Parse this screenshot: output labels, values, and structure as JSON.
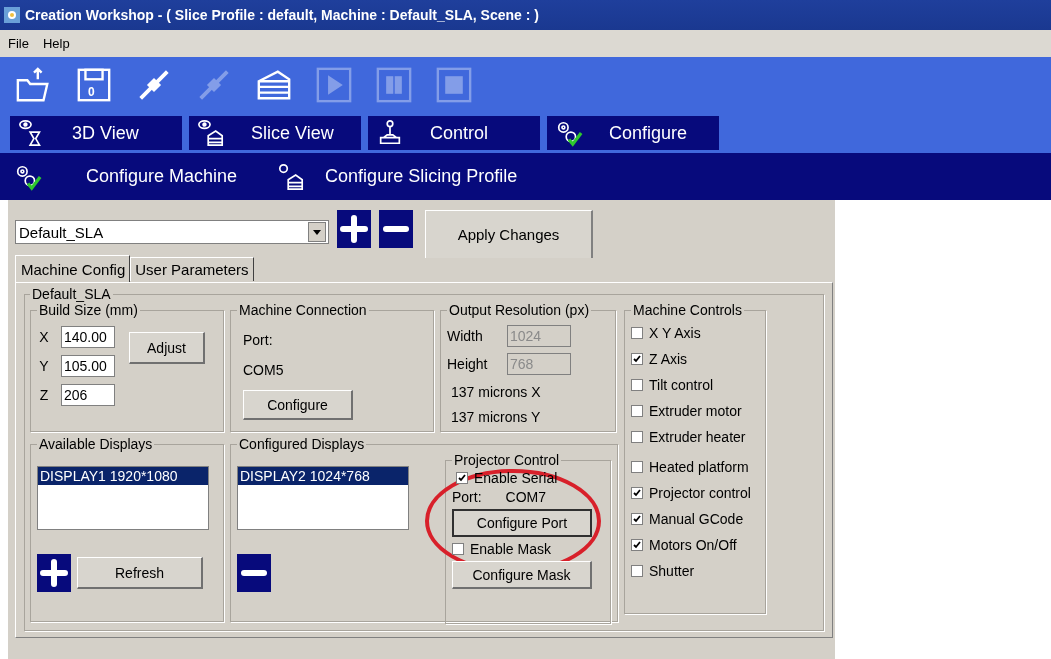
{
  "window": {
    "title": "Creation Workshop -   ( Slice Profile : default, Machine : Default_SLA, Scene : )"
  },
  "menu": [
    "File",
    "Help"
  ],
  "toolbar": [
    {
      "kind": "open",
      "disabled": false
    },
    {
      "kind": "save",
      "label": "0",
      "disabled": false
    },
    {
      "kind": "connect",
      "disabled": false
    },
    {
      "kind": "disconnect",
      "disabled": true
    },
    {
      "kind": "slice",
      "disabled": false
    },
    {
      "kind": "play",
      "disabled": true
    },
    {
      "kind": "pause",
      "disabled": true
    },
    {
      "kind": "stop",
      "disabled": true
    }
  ],
  "nav_tabs": [
    {
      "kind": "view3d",
      "label": "3D View"
    },
    {
      "kind": "slice",
      "label": "Slice View"
    },
    {
      "kind": "control",
      "label": "Control"
    },
    {
      "kind": "configure",
      "label": "Configure"
    }
  ],
  "sub_tabs": [
    {
      "kind": "configure",
      "label": "Configure Machine"
    },
    {
      "kind": "slice",
      "label": "Configure Slicing Profile"
    }
  ],
  "profile_select": {
    "value": "Default_SLA"
  },
  "apply_button": "Apply Changes",
  "config_tabs": [
    {
      "label": "Machine Config",
      "selected": true
    },
    {
      "label": "User Parameters",
      "selected": false
    }
  ],
  "machine_group": {
    "title": "Default_SLA"
  },
  "build_size": {
    "title": "Build Size (mm)",
    "fields": [
      {
        "label": "X",
        "value": "140.00"
      },
      {
        "label": "Y",
        "value": "105.00"
      },
      {
        "label": "Z",
        "value": "206"
      }
    ],
    "button": "Adjust"
  },
  "machine_connection": {
    "title": "Machine Connection",
    "port_label": "Port:",
    "port": "COM5",
    "button": "Configure"
  },
  "output_resolution": {
    "title": "Output Resolution (px)",
    "fields": [
      {
        "label": "Width",
        "value": "1024",
        "disabled": true
      },
      {
        "label": "Height",
        "value": "768",
        "disabled": true
      }
    ],
    "microns_x": "137 microns X",
    "microns_y": "137 microns Y"
  },
  "machine_controls": {
    "title": "Machine Controls",
    "items": [
      {
        "label": "X Y Axis",
        "checked": false
      },
      {
        "label": "Z Axis",
        "checked": true
      },
      {
        "label": "Tilt control",
        "checked": false
      },
      {
        "label": "Extruder motor",
        "checked": false
      },
      {
        "label": "Extruder heater",
        "checked": false
      },
      {
        "label": "Heated platform",
        "checked": false
      },
      {
        "label": "Projector control",
        "checked": true
      },
      {
        "label": "Manual GCode",
        "checked": true
      },
      {
        "label": "Motors On/Off",
        "checked": true
      },
      {
        "label": "Shutter",
        "checked": false
      }
    ]
  },
  "available_displays": {
    "title": "Available Displays",
    "items": [
      {
        "label": "DISPLAY1 1920*1080",
        "selected": true
      }
    ],
    "button": "Refresh"
  },
  "configured_displays": {
    "title": "Configured Displays",
    "items": [
      {
        "label": "DISPLAY2 1024*768",
        "selected": true
      }
    ]
  },
  "projector_control": {
    "title": "Projector Control",
    "enable_serial": {
      "label": "Enable Serial",
      "checked": true
    },
    "port_label": "Port:",
    "port": "COM7",
    "configure_port": "Configure Port",
    "enable_mask": {
      "label": "Enable Mask",
      "checked": false
    },
    "configure_mask": "Configure Mask"
  }
}
